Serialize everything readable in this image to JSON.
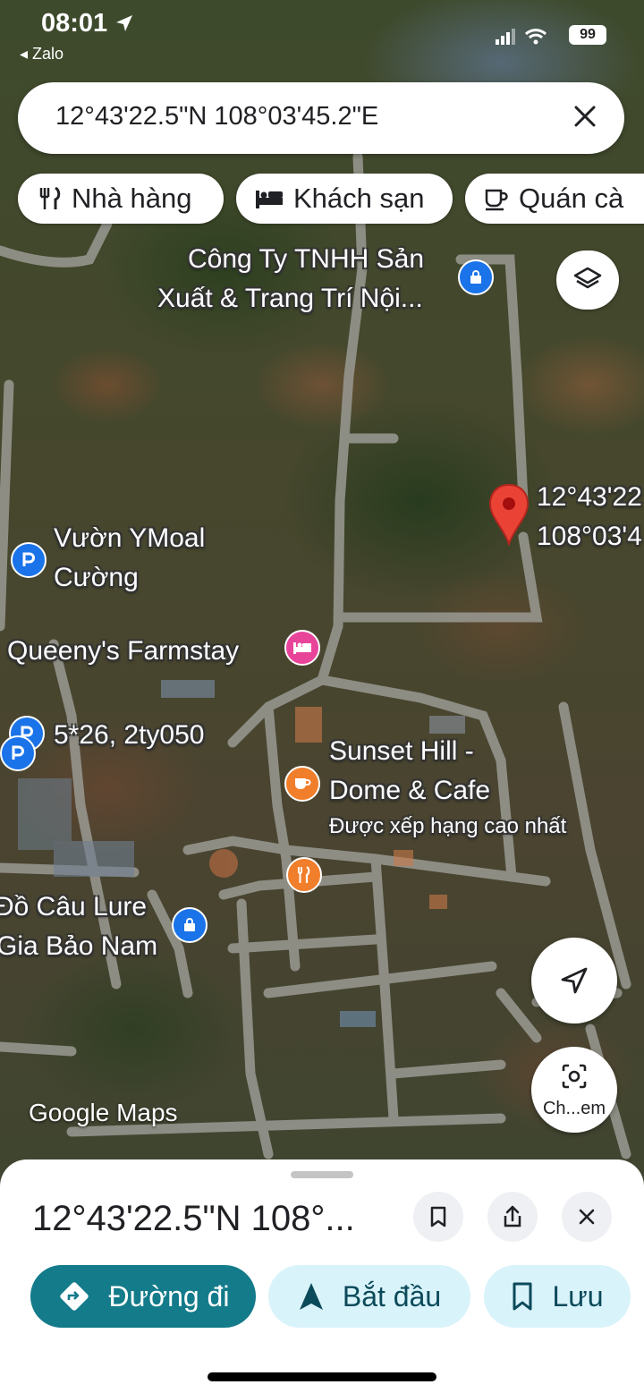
{
  "status_bar": {
    "time": "08:01",
    "back_app": "Zalo",
    "battery": "99"
  },
  "search": {
    "query": "12°43'22.5\"N 108°03'45.2\"E"
  },
  "chips": [
    {
      "label": "Nhà hàng",
      "icon": "utensils-icon"
    },
    {
      "label": "Khách sạn",
      "icon": "bed-icon"
    },
    {
      "label": "Quán cà",
      "icon": "coffee-cup-icon"
    }
  ],
  "map": {
    "labels": {
      "company": [
        "Công Ty TNHH Sản",
        "Xuất & Trang Trí Nội..."
      ],
      "garden": [
        "Vườn YMoal",
        "Cường"
      ],
      "farmstay": "Queeny's Farmstay",
      "lot": "5*26, 2ty050",
      "sunset": [
        "Sunset Hill -",
        "Dome & Cafe"
      ],
      "sunset_note": "Được xếp hạng cao nhất",
      "fishing": [
        "Đồ Câu Lure",
        "Gia Bảo Nam"
      ],
      "pin": [
        "12°43'22",
        "108°03'4"
      ]
    },
    "colors": {
      "pin": "#ea4335",
      "parking_poi": "#1a73e8",
      "hotel_poi": "#e8449a",
      "food_poi": "#f07e2b",
      "shop_poi": "#1a73e8"
    },
    "watermark": "Google Maps",
    "scan_label": "Ch...em"
  },
  "sheet": {
    "title": "12°43'22.5\"N 108°...",
    "directions_label": "Đường đi",
    "start_label": "Bắt đầu",
    "save_label": "Lưu",
    "accent": "#137b8a",
    "light_button": "#d9f3fa"
  }
}
